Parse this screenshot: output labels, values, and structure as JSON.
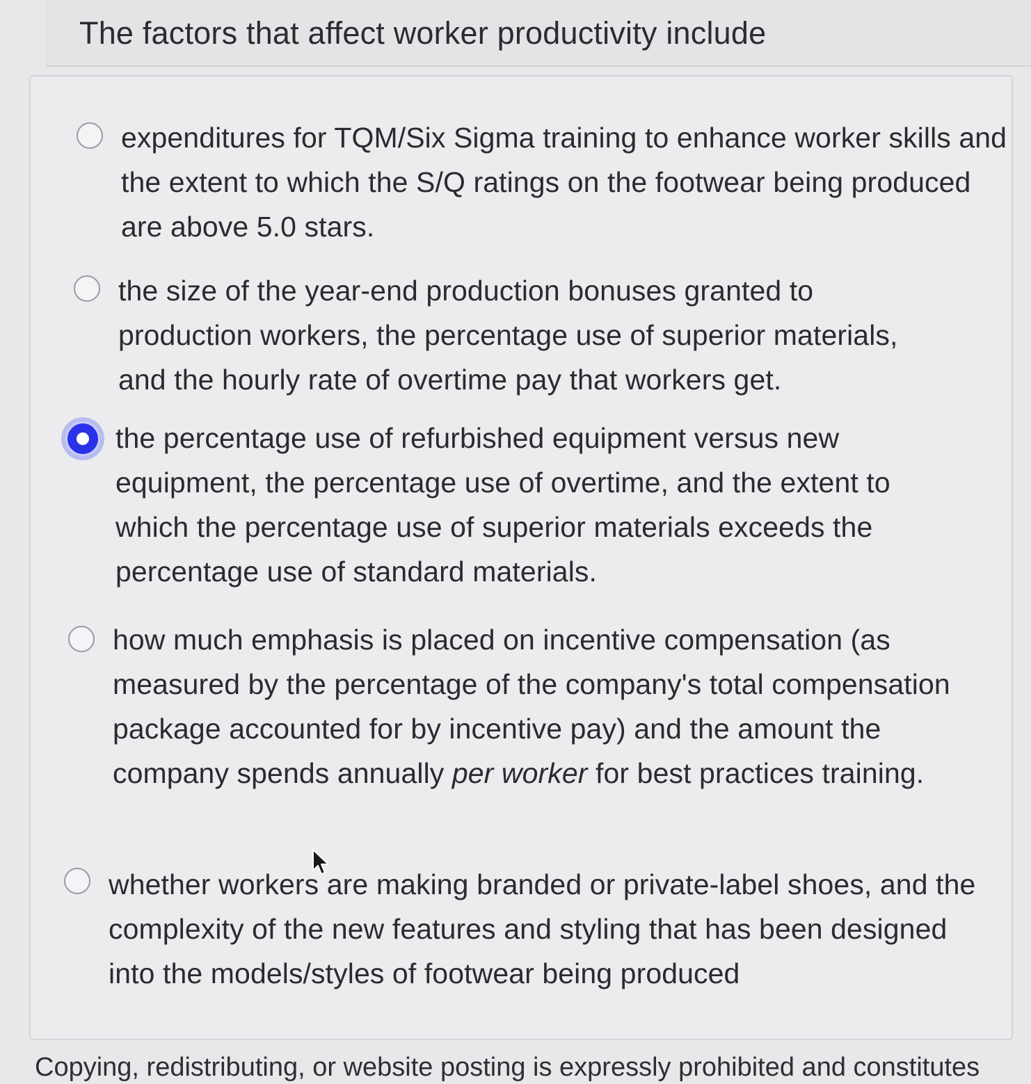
{
  "question": {
    "text": "The factors that affect worker productivity include"
  },
  "options": [
    {
      "text": "expenditures for TQM/Six Sigma training to enhance worker skills and the extent to which the S/Q ratings on the footwear being produced are above 5.0 stars.",
      "selected": false
    },
    {
      "text": "the size of the year-end production bonuses granted to production workers, the percentage use of superior materials, and the hourly rate of overtime pay that workers get.",
      "selected": false
    },
    {
      "text": "the percentage use of refurbished equipment versus new equipment, the percentage use of overtime, and the extent to which the percentage use of superior materials exceeds the percentage use of standard materials.",
      "selected": true
    },
    {
      "text_before": "how much emphasis is placed on incentive compensation (as measured by the percentage of the company's total compensation package accounted for by incentive pay) and the amount the company spends annually ",
      "text_italic": "per worker",
      "text_after": " for best practices training.",
      "selected": false
    },
    {
      "text": "whether workers are making branded or private-label shoes, and the complexity of the new features and styling that has been designed into the models/styles of footwear being produced",
      "selected": false
    }
  ],
  "footer": {
    "text": "Copying, redistributing, or website posting is expressly prohibited and constitutes"
  },
  "colors": {
    "selected_radio": "#2a32e8",
    "background": "#e8e8ea"
  },
  "icons": {
    "cursor": "mouse-pointer-icon"
  }
}
